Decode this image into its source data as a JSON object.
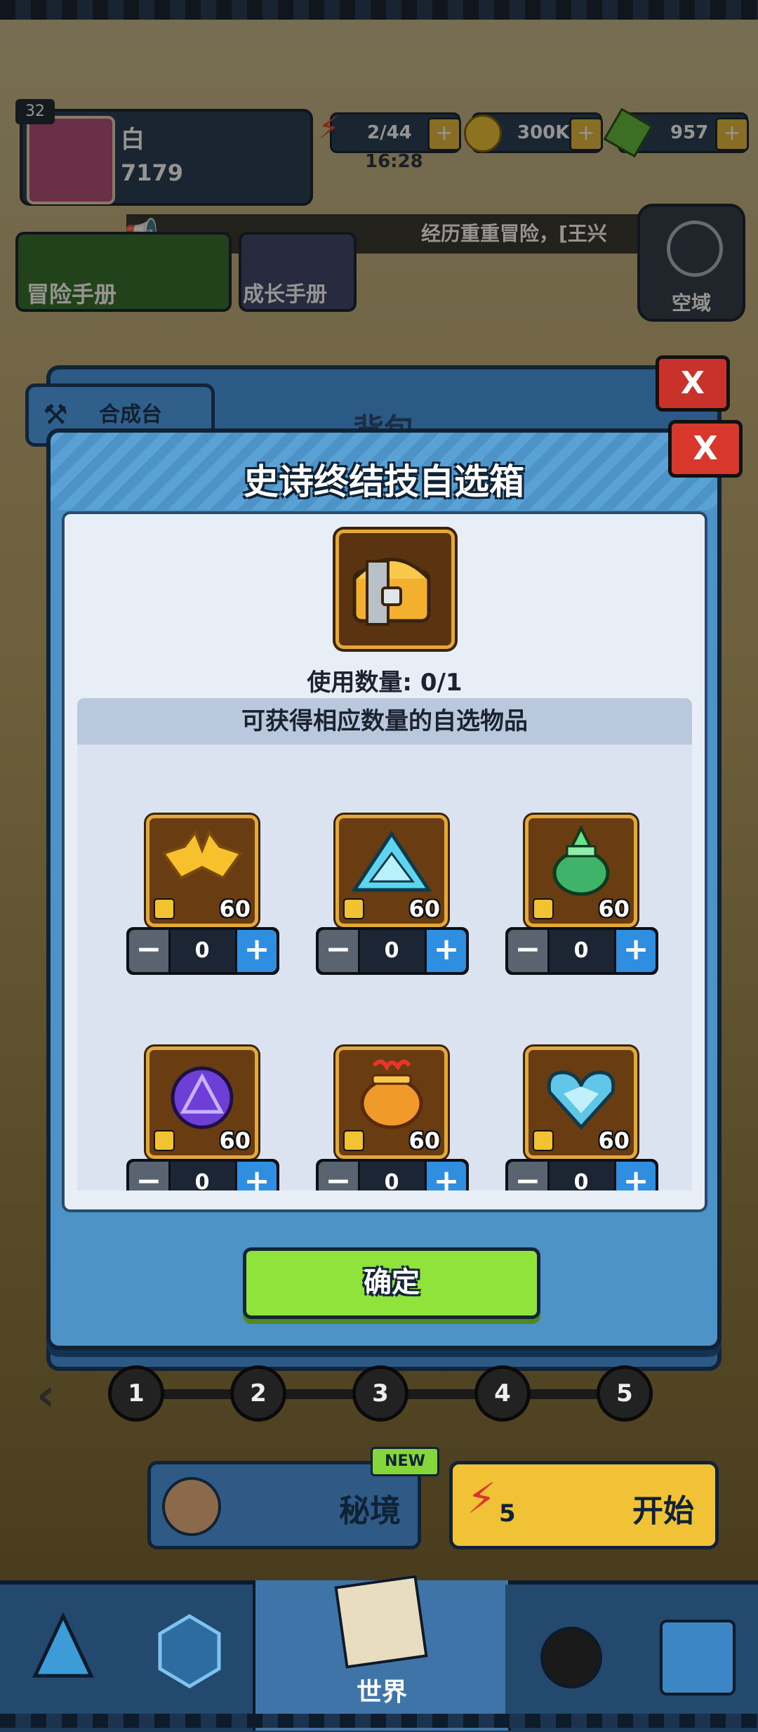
{
  "player": {
    "level": "32",
    "name": "白",
    "power": "7179"
  },
  "resources": {
    "energy": "2/44",
    "energy_timer": "16:28",
    "gold": "300K",
    "gems": "957"
  },
  "marquee": {
    "text": "经历重重冒险，[王兴"
  },
  "manuals": {
    "adventure": "冒险手册",
    "growth": "成长手册"
  },
  "realm": {
    "label": "空域"
  },
  "bag": {
    "title": "背包",
    "craft_tab": "合成台",
    "close": "X"
  },
  "dialog": {
    "title": "史诗终结技自选箱",
    "close": "X",
    "use_count": "使用数量: 0/1",
    "subheader": "可获得相应数量的自选物品",
    "confirm": "确定",
    "items": [
      {
        "name": "golden-bat-item",
        "qty": "60",
        "count": "0"
      },
      {
        "name": "ice-triangle-amulet-item",
        "qty": "60",
        "count": "0"
      },
      {
        "name": "jade-lantern-item",
        "qty": "60",
        "count": "0"
      },
      {
        "name": "purple-rune-orb-item",
        "qty": "60",
        "count": "0"
      },
      {
        "name": "fire-pot-item",
        "qty": "60",
        "count": "0"
      },
      {
        "name": "ice-heart-pendant-item",
        "qty": "60",
        "count": "0"
      }
    ],
    "stepper_minus": "−",
    "stepper_plus": "+"
  },
  "stages": [
    "1",
    "2",
    "3",
    "4",
    "5"
  ],
  "bottom_buttons": {
    "secret_realm": "秘境",
    "new_badge": "NEW",
    "start": "开始",
    "start_cost": "5"
  },
  "nav": {
    "world": "世界"
  },
  "colors": {
    "confirm": "#8fe33a",
    "close": "#d8372c",
    "dialog": "#4d93c8",
    "start": "#f2c236"
  }
}
